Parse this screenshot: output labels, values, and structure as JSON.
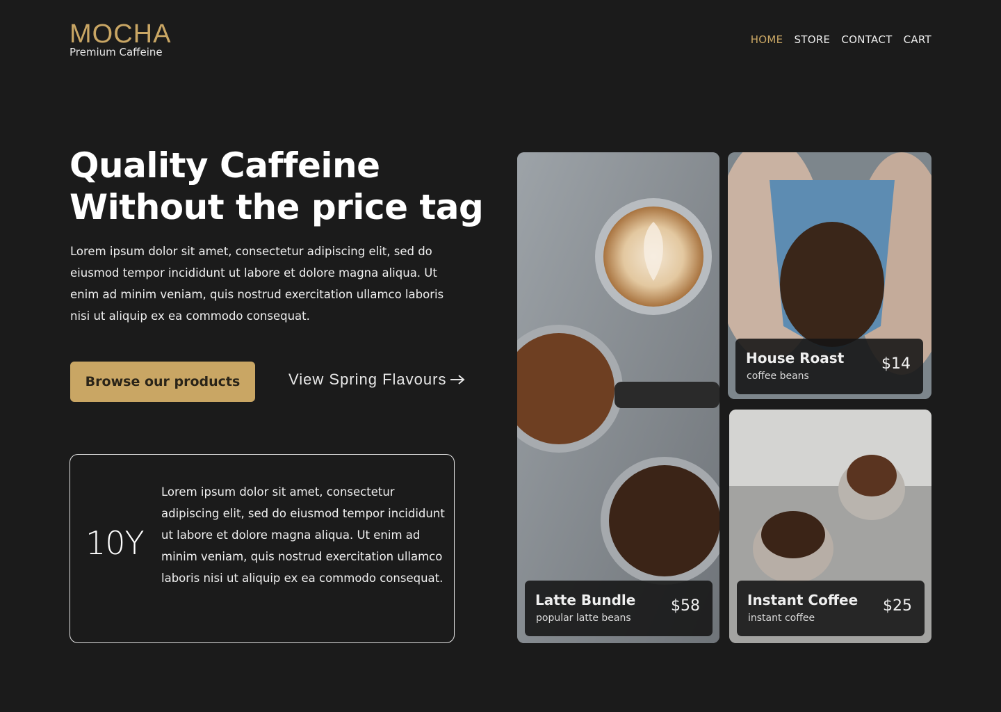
{
  "brand": {
    "name": "MOCHA",
    "tagline": "Premium Caffeine"
  },
  "nav": [
    {
      "label": "HOME",
      "active": true
    },
    {
      "label": "STORE",
      "active": false
    },
    {
      "label": "CONTACT",
      "active": false
    },
    {
      "label": "CART",
      "active": false
    }
  ],
  "hero": {
    "title_line1": "Quality Caffeine",
    "title_line2": "Without the price tag",
    "body": "Lorem ipsum dolor sit amet, consectetur adipiscing elit, sed do eiusmod tempor incididunt ut labore et dolore magna aliqua. Ut enim ad minim veniam, quis nostrud exercitation ullamco laboris nisi ut aliquip ex ea commodo consequat.",
    "primary_button": "Browse our products",
    "secondary_link": "View Spring Flavours"
  },
  "stat": {
    "value": "10Y",
    "text": "Lorem ipsum dolor sit amet, consectetur adipiscing elit, sed do eiusmod tempor incididunt ut labore et dolore magna aliqua. Ut enim ad minim veniam, quis nostrud exercitation ullamco laboris nisi ut aliquip ex ea commodo consequat."
  },
  "products": [
    {
      "name": "Latte Bundle",
      "sub": "popular latte beans",
      "price": "$58"
    },
    {
      "name": "House Roast",
      "sub": "coffee beans",
      "price": "$14"
    },
    {
      "name": "Instant Coffee",
      "sub": "instant coffee",
      "price": "$25"
    }
  ],
  "colors": {
    "background": "#1b1b1b",
    "accent": "#c9a664",
    "text": "#ffffff"
  },
  "icons": {
    "arrow": "arrow-right-icon"
  }
}
